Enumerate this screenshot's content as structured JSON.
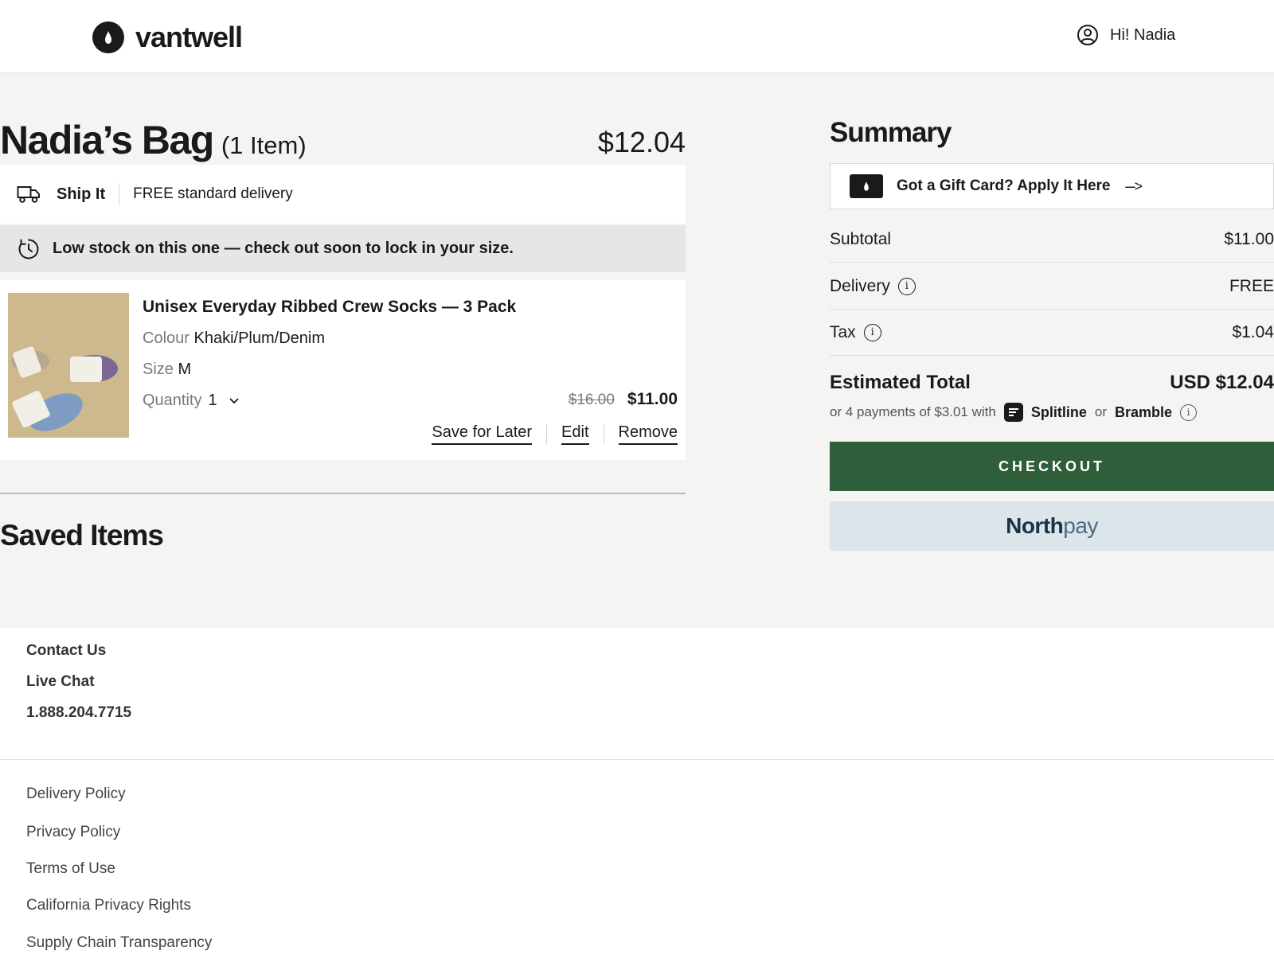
{
  "header": {
    "brand": "vantwell",
    "greeting": "Hi! Nadia"
  },
  "bag": {
    "title": "Nadia’s Bag",
    "item_count": "(1 Item)",
    "total": "$12.04",
    "shipping": {
      "label": "Ship It",
      "description": "FREE standard delivery"
    },
    "stock_notice": "Low stock on this one — check out soon to lock in your size.",
    "item": {
      "name": "Unisex Everyday Ribbed Crew Socks — 3 Pack",
      "colour_label": "Colour",
      "colour_value": "Khaki/Plum/Denim",
      "size_label": "Size",
      "size_value": "M",
      "quantity_label": "Quantity",
      "quantity_value": "1",
      "original_price": "$16.00",
      "price": "$11.00",
      "actions": {
        "save_for_later": "Save for Later",
        "edit": "Edit",
        "remove": "Remove"
      }
    }
  },
  "saved_items": {
    "title": "Saved Items"
  },
  "summary": {
    "title": "Summary",
    "gift_card": "Got a Gift Card? Apply It Here",
    "gift_arrow": "--->",
    "subtotal_label": "Subtotal",
    "subtotal_value": "$11.00",
    "delivery_label": "Delivery",
    "delivery_value": "FREE",
    "tax_label": "Tax",
    "tax_value": "$1.04",
    "estimated_total_label": "Estimated Total",
    "estimated_total_value": "USD $12.04",
    "payments_text": "or 4 payments of $3.01 with",
    "payments_brand_1": "Splitline",
    "payments_or": "or",
    "payments_brand_2": "Bramble",
    "checkout_label": "CHECKOUT",
    "express_bold": "North",
    "express_light": "pay"
  },
  "footer": {
    "contact_us": "Contact Us",
    "live_chat": "Live Chat",
    "phone": "1.888.204.7715",
    "links": [
      "Delivery Policy",
      "Privacy Policy",
      "Terms of Use",
      "California Privacy Rights",
      "Supply Chain Transparency"
    ]
  },
  "colors": {
    "accent_checkout": "#2e5e3a",
    "express_background": "#dbe5ea",
    "page_background": "#f4f4f2"
  }
}
